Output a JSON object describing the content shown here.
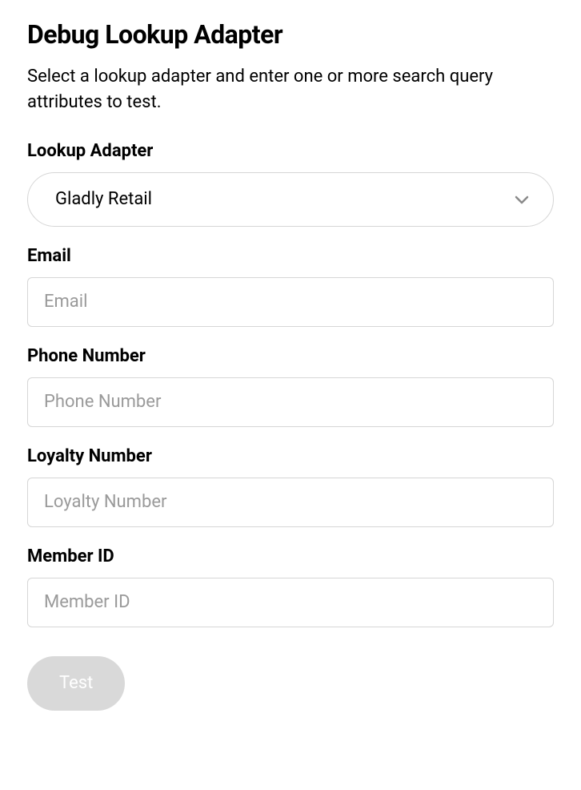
{
  "page": {
    "title": "Debug Lookup Adapter",
    "description": "Select a lookup adapter and enter one or more search query attributes to test."
  },
  "form": {
    "lookup_adapter": {
      "label": "Lookup Adapter",
      "selected": "Gladly Retail"
    },
    "email": {
      "label": "Email",
      "placeholder": "Email",
      "value": ""
    },
    "phone_number": {
      "label": "Phone Number",
      "placeholder": "Phone Number",
      "value": ""
    },
    "loyalty_number": {
      "label": "Loyalty Number",
      "placeholder": "Loyalty Number",
      "value": ""
    },
    "member_id": {
      "label": "Member ID",
      "placeholder": "Member ID",
      "value": ""
    },
    "test_button": {
      "label": "Test"
    }
  }
}
